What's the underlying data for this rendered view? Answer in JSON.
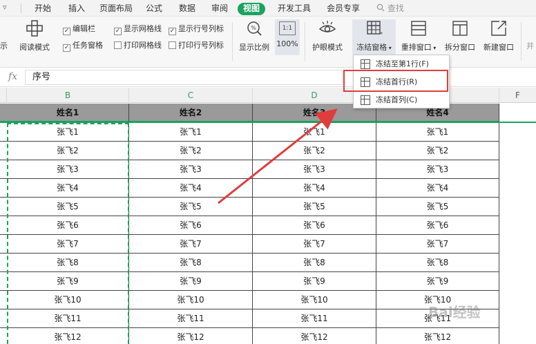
{
  "menubar": {
    "qa_icon": "▿",
    "tabs": [
      "开始",
      "插入",
      "页面布局",
      "公式",
      "数据",
      "审阅",
      "视图",
      "开发工具",
      "会员专享"
    ],
    "active_tab": "视图",
    "search_label": "查找"
  },
  "ribbon": {
    "show_partial": "示",
    "reading_mode": "阅读模式",
    "checkboxes": {
      "edit_bar": "编辑栏",
      "show_grid": "显示网格线",
      "show_headers": "显示行号列标",
      "task_pane": "任务窗格",
      "print_grid": "打印网格线",
      "print_headers": "打印行号列标"
    },
    "zoom_label": "显示比例",
    "zoom_value": "100%",
    "zoom_icon_text": "1:1",
    "eye_mode": "护眼模式",
    "freeze_panes": "冻结窗格",
    "rearrange": "重排窗口",
    "split": "拆分窗口",
    "new_window": "新建窗口",
    "more_partial": "并"
  },
  "formula_bar": {
    "fx": "fx",
    "content": "序号"
  },
  "columns": [
    "B",
    "C",
    "D",
    "F"
  ],
  "dropdown": {
    "items": [
      "冻结至第1行(F)",
      "冻结首行(R)",
      "冻结首列(C)"
    ]
  },
  "table": {
    "headers": [
      "姓名1",
      "姓名2",
      "姓名3",
      "姓名4"
    ],
    "rows": [
      [
        "张飞1",
        "张飞1",
        "张飞1",
        "张飞1"
      ],
      [
        "张飞2",
        "张飞2",
        "张飞2",
        "张飞2"
      ],
      [
        "张飞3",
        "张飞3",
        "张飞3",
        "张飞3"
      ],
      [
        "张飞4",
        "张飞4",
        "张飞4",
        "张飞4"
      ],
      [
        "张飞5",
        "张飞5",
        "张飞5",
        "张飞5"
      ],
      [
        "张飞6",
        "张飞6",
        "张飞6",
        "张飞6"
      ],
      [
        "张飞7",
        "张飞7",
        "张飞7",
        "张飞7"
      ],
      [
        "张飞8",
        "张飞8",
        "张飞8",
        "张飞8"
      ],
      [
        "张飞9",
        "张飞9",
        "张飞9",
        "张飞9"
      ],
      [
        "张飞10",
        "张飞10",
        "张飞10",
        "张飞10"
      ],
      [
        "张飞11",
        "张飞11",
        "张飞11",
        "张飞11"
      ],
      [
        "张飞12",
        "张飞12",
        "张飞12",
        "张飞12"
      ]
    ]
  },
  "watermark": "Bai经验",
  "colors": {
    "accent_green": "#1aa260",
    "highlight_red": "#e03c3c",
    "header_gray": "#9a9a9a"
  }
}
